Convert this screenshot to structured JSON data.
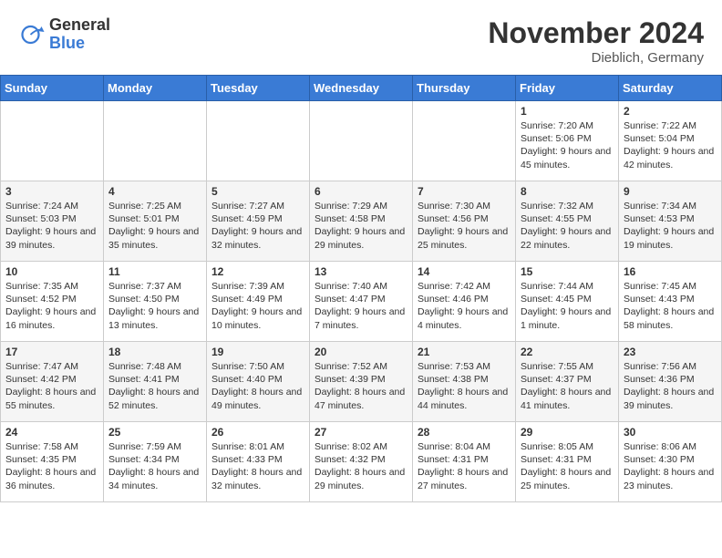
{
  "header": {
    "logo_general": "General",
    "logo_blue": "Blue",
    "month_title": "November 2024",
    "location": "Dieblich, Germany"
  },
  "weekdays": [
    "Sunday",
    "Monday",
    "Tuesday",
    "Wednesday",
    "Thursday",
    "Friday",
    "Saturday"
  ],
  "weeks": [
    [
      {
        "day": "",
        "info": ""
      },
      {
        "day": "",
        "info": ""
      },
      {
        "day": "",
        "info": ""
      },
      {
        "day": "",
        "info": ""
      },
      {
        "day": "",
        "info": ""
      },
      {
        "day": "1",
        "info": "Sunrise: 7:20 AM\nSunset: 5:06 PM\nDaylight: 9 hours and 45 minutes."
      },
      {
        "day": "2",
        "info": "Sunrise: 7:22 AM\nSunset: 5:04 PM\nDaylight: 9 hours and 42 minutes."
      }
    ],
    [
      {
        "day": "3",
        "info": "Sunrise: 7:24 AM\nSunset: 5:03 PM\nDaylight: 9 hours and 39 minutes."
      },
      {
        "day": "4",
        "info": "Sunrise: 7:25 AM\nSunset: 5:01 PM\nDaylight: 9 hours and 35 minutes."
      },
      {
        "day": "5",
        "info": "Sunrise: 7:27 AM\nSunset: 4:59 PM\nDaylight: 9 hours and 32 minutes."
      },
      {
        "day": "6",
        "info": "Sunrise: 7:29 AM\nSunset: 4:58 PM\nDaylight: 9 hours and 29 minutes."
      },
      {
        "day": "7",
        "info": "Sunrise: 7:30 AM\nSunset: 4:56 PM\nDaylight: 9 hours and 25 minutes."
      },
      {
        "day": "8",
        "info": "Sunrise: 7:32 AM\nSunset: 4:55 PM\nDaylight: 9 hours and 22 minutes."
      },
      {
        "day": "9",
        "info": "Sunrise: 7:34 AM\nSunset: 4:53 PM\nDaylight: 9 hours and 19 minutes."
      }
    ],
    [
      {
        "day": "10",
        "info": "Sunrise: 7:35 AM\nSunset: 4:52 PM\nDaylight: 9 hours and 16 minutes."
      },
      {
        "day": "11",
        "info": "Sunrise: 7:37 AM\nSunset: 4:50 PM\nDaylight: 9 hours and 13 minutes."
      },
      {
        "day": "12",
        "info": "Sunrise: 7:39 AM\nSunset: 4:49 PM\nDaylight: 9 hours and 10 minutes."
      },
      {
        "day": "13",
        "info": "Sunrise: 7:40 AM\nSunset: 4:47 PM\nDaylight: 9 hours and 7 minutes."
      },
      {
        "day": "14",
        "info": "Sunrise: 7:42 AM\nSunset: 4:46 PM\nDaylight: 9 hours and 4 minutes."
      },
      {
        "day": "15",
        "info": "Sunrise: 7:44 AM\nSunset: 4:45 PM\nDaylight: 9 hours and 1 minute."
      },
      {
        "day": "16",
        "info": "Sunrise: 7:45 AM\nSunset: 4:43 PM\nDaylight: 8 hours and 58 minutes."
      }
    ],
    [
      {
        "day": "17",
        "info": "Sunrise: 7:47 AM\nSunset: 4:42 PM\nDaylight: 8 hours and 55 minutes."
      },
      {
        "day": "18",
        "info": "Sunrise: 7:48 AM\nSunset: 4:41 PM\nDaylight: 8 hours and 52 minutes."
      },
      {
        "day": "19",
        "info": "Sunrise: 7:50 AM\nSunset: 4:40 PM\nDaylight: 8 hours and 49 minutes."
      },
      {
        "day": "20",
        "info": "Sunrise: 7:52 AM\nSunset: 4:39 PM\nDaylight: 8 hours and 47 minutes."
      },
      {
        "day": "21",
        "info": "Sunrise: 7:53 AM\nSunset: 4:38 PM\nDaylight: 8 hours and 44 minutes."
      },
      {
        "day": "22",
        "info": "Sunrise: 7:55 AM\nSunset: 4:37 PM\nDaylight: 8 hours and 41 minutes."
      },
      {
        "day": "23",
        "info": "Sunrise: 7:56 AM\nSunset: 4:36 PM\nDaylight: 8 hours and 39 minutes."
      }
    ],
    [
      {
        "day": "24",
        "info": "Sunrise: 7:58 AM\nSunset: 4:35 PM\nDaylight: 8 hours and 36 minutes."
      },
      {
        "day": "25",
        "info": "Sunrise: 7:59 AM\nSunset: 4:34 PM\nDaylight: 8 hours and 34 minutes."
      },
      {
        "day": "26",
        "info": "Sunrise: 8:01 AM\nSunset: 4:33 PM\nDaylight: 8 hours and 32 minutes."
      },
      {
        "day": "27",
        "info": "Sunrise: 8:02 AM\nSunset: 4:32 PM\nDaylight: 8 hours and 29 minutes."
      },
      {
        "day": "28",
        "info": "Sunrise: 8:04 AM\nSunset: 4:31 PM\nDaylight: 8 hours and 27 minutes."
      },
      {
        "day": "29",
        "info": "Sunrise: 8:05 AM\nSunset: 4:31 PM\nDaylight: 8 hours and 25 minutes."
      },
      {
        "day": "30",
        "info": "Sunrise: 8:06 AM\nSunset: 4:30 PM\nDaylight: 8 hours and 23 minutes."
      }
    ]
  ]
}
